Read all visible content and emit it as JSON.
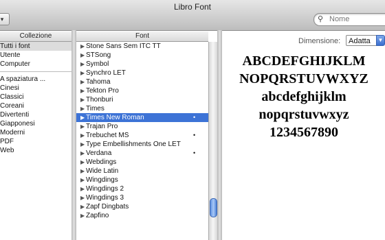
{
  "window": {
    "title": "Libro Font"
  },
  "toolbar": {
    "action_label": "▾",
    "search_placeholder": "Nome"
  },
  "columns": {
    "collection_header": "Collezione",
    "font_header": "Font"
  },
  "collections": {
    "group1": [
      "Tutti i font",
      "Utente",
      "Computer"
    ],
    "group2": [
      "A spaziatura ...",
      "Cinesi",
      "Classici",
      "Coreani",
      "Divertenti",
      "Giapponesi",
      "Moderni",
      "PDF",
      "Web"
    ]
  },
  "fonts": [
    "Stone Sans Sem ITC TT",
    "STSong",
    "Symbol",
    "Synchro LET",
    "Tahoma",
    "Tekton Pro",
    "Thonburi",
    "Times",
    "Times New Roman",
    "Trajan Pro",
    "Trebuchet MS",
    "Type Embellishments One LET",
    "Verdana",
    "Webdings",
    "Wide Latin",
    "Wingdings",
    "Wingdings 2",
    "Wingdings 3",
    "Zapf Dingbats",
    "Zapfino"
  ],
  "font_dots": [
    "",
    "",
    "",
    "",
    "",
    "",
    "",
    "",
    "•",
    "",
    "•",
    "",
    "•",
    "",
    "",
    "",
    "",
    "",
    "",
    ""
  ],
  "selected_font_index": 8,
  "preview": {
    "size_label": "Dimensione:",
    "size_value": "Adatta",
    "lines": [
      "ABCDEFGHIJKLM",
      "NOPQRSTUVWXYZ",
      "abcdefghijklm",
      "nopqrstuvwxyz",
      "1234567890"
    ]
  },
  "colors": {
    "selection": "#3d73d6"
  }
}
